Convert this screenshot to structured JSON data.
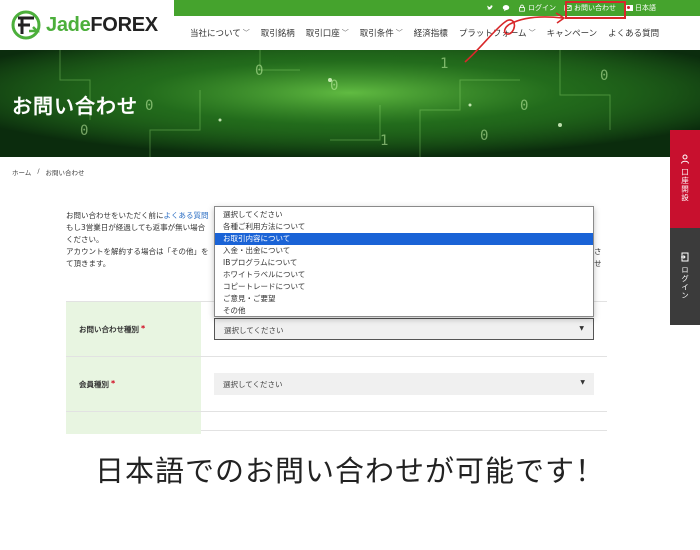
{
  "logo": {
    "jade": "Jade",
    "forex": "FOREX"
  },
  "topbar": {
    "login": "ログイン",
    "contact": "お問い合わせ",
    "language": "日本語"
  },
  "nav": [
    {
      "label": "当社について",
      "chevron": true
    },
    {
      "label": "取引銘柄",
      "chevron": false
    },
    {
      "label": "取引口座",
      "chevron": true
    },
    {
      "label": "取引条件",
      "chevron": true
    },
    {
      "label": "経済指標",
      "chevron": false
    },
    {
      "label": "プラットフォーム",
      "chevron": true
    },
    {
      "label": "キャンペーン",
      "chevron": false
    },
    {
      "label": "よくある質問",
      "chevron": false
    }
  ],
  "hero": {
    "title": "お問い合わせ"
  },
  "breadcrumb": {
    "home": "ホーム",
    "separator": "/",
    "current": "お問い合わせ"
  },
  "side_tabs": {
    "account": "口座開設",
    "login": "ログイン"
  },
  "intro": {
    "line1_pre": "お問い合わせをいただく前に",
    "line1_link": "よくある質問",
    "line2": "もし3営業日が経過しても返事が無い場合",
    "line3": "ください。",
    "line4": "アカウントを解約する場合は「その他」を",
    "line5": "て頂きます。",
    "tail": "させ"
  },
  "form": {
    "inquiry_type": {
      "label": "お問い合わせ種別",
      "required": "*",
      "value": "選択してください"
    },
    "member_type": {
      "label": "会員種別",
      "required": "*",
      "value": "選択してください"
    }
  },
  "dropdown_options": [
    "選択してください",
    "各種ご利用方法について",
    "お取引内容について",
    "入金・出金について",
    "IBプログラムについて",
    "ホワイトラベルについて",
    "コピートレードについて",
    "ご意見・ご要望",
    "その他"
  ],
  "dropdown_highlighted_index": 2,
  "caption": "日本語でのお問い合わせが可能です！",
  "colors": {
    "brand_green": "#45a32d",
    "hero_green": "#0f3d12",
    "side_red": "#c8102e",
    "highlight_red": "#d8282a",
    "select_blue": "#1a63d6"
  }
}
